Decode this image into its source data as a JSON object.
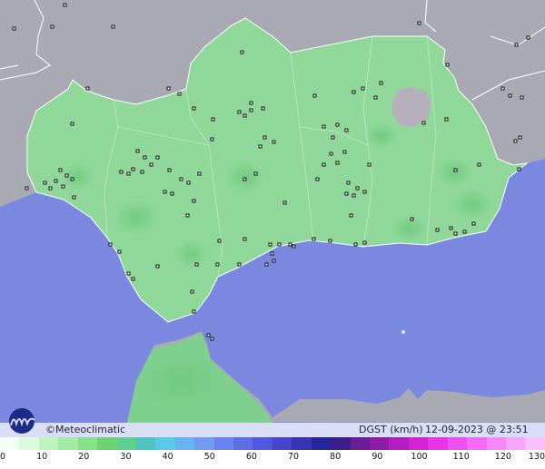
{
  "brand": {
    "name": "©Meteoclimatic",
    "logo_icon": "meteoclimatic-logo-icon"
  },
  "product": {
    "label": "DGST (km/h)",
    "timestamp": "12-09-2023 @ 23:51 UTC"
  },
  "scale": {
    "unit": "km/h",
    "ticks": [
      "0",
      "10",
      "20",
      "30",
      "40",
      "50",
      "60",
      "70",
      "80",
      "90",
      "100",
      "110",
      "120",
      "130"
    ],
    "colors": [
      "#f3fff3",
      "#dcfadc",
      "#bdf3bd",
      "#a2eca2",
      "#86e286",
      "#6ed36e",
      "#5fcf8f",
      "#4fc4c0",
      "#5ac8e8",
      "#67b4ee",
      "#6f9cf1",
      "#6a84ee",
      "#5c6ee6",
      "#4f59dc",
      "#4444cc",
      "#3535b4",
      "#26269a",
      "#3a1f8c",
      "#6a1d96",
      "#8e1ca8",
      "#b21ebf",
      "#d424d4",
      "#e834e8",
      "#f050f0",
      "#f46cf4",
      "#f888f8",
      "#faa4fa",
      "#fcc0fc"
    ]
  },
  "colors": {
    "sea": "#7b88e0",
    "land_outside": "#a9a9b3",
    "region_fill": "#8fd89a",
    "station_marker": "#111111"
  }
}
